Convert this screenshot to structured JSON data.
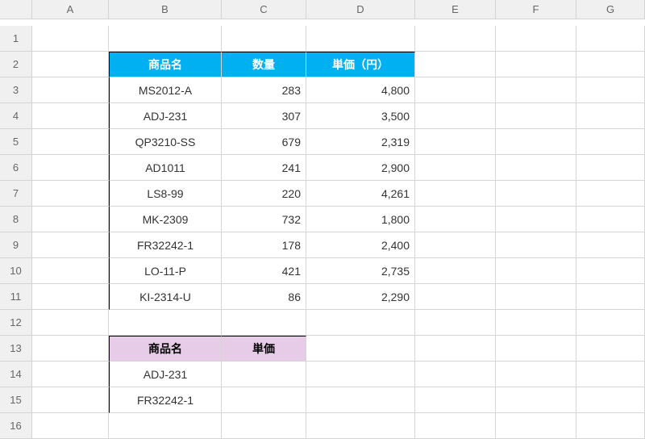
{
  "columns": [
    "A",
    "B",
    "C",
    "D",
    "E",
    "F",
    "G"
  ],
  "rows": [
    "1",
    "2",
    "3",
    "4",
    "5",
    "6",
    "7",
    "8",
    "9",
    "10",
    "11",
    "12",
    "13",
    "14",
    "15",
    "16"
  ],
  "table1": {
    "headers": {
      "product": "商品名",
      "quantity": "数量",
      "price": "単価（円）"
    },
    "data": [
      {
        "product": "MS2012-A",
        "quantity": "283",
        "price": "4,800"
      },
      {
        "product": "ADJ-231",
        "quantity": "307",
        "price": "3,500"
      },
      {
        "product": "QP3210-SS",
        "quantity": "679",
        "price": "2,319"
      },
      {
        "product": "AD1011",
        "quantity": "241",
        "price": "2,900"
      },
      {
        "product": "LS8-99",
        "quantity": "220",
        "price": "4,261"
      },
      {
        "product": "MK-2309",
        "quantity": "732",
        "price": "1,800"
      },
      {
        "product": "FR32242-1",
        "quantity": "178",
        "price": "2,400"
      },
      {
        "product": "LO-11-P",
        "quantity": "421",
        "price": "2,735"
      },
      {
        "product": "KI-2314-U",
        "quantity": "86",
        "price": "2,290"
      }
    ]
  },
  "table2": {
    "headers": {
      "product": "商品名",
      "price": "単価"
    },
    "data": [
      {
        "product": "ADJ-231",
        "price": ""
      },
      {
        "product": "FR32242-1",
        "price": ""
      }
    ]
  },
  "chart_data": {
    "type": "table",
    "tables": [
      {
        "title": "商品一覧",
        "columns": [
          "商品名",
          "数量",
          "単価（円）"
        ],
        "rows": [
          [
            "MS2012-A",
            283,
            4800
          ],
          [
            "ADJ-231",
            307,
            3500
          ],
          [
            "QP3210-SS",
            679,
            2319
          ],
          [
            "AD1011",
            241,
            2900
          ],
          [
            "LS8-99",
            220,
            4261
          ],
          [
            "MK-2309",
            732,
            1800
          ],
          [
            "FR32242-1",
            178,
            2400
          ],
          [
            "LO-11-P",
            421,
            2735
          ],
          [
            "KI-2314-U",
            86,
            2290
          ]
        ]
      },
      {
        "title": "検索",
        "columns": [
          "商品名",
          "単価"
        ],
        "rows": [
          [
            "ADJ-231",
            null
          ],
          [
            "FR32242-1",
            null
          ]
        ]
      }
    ]
  }
}
